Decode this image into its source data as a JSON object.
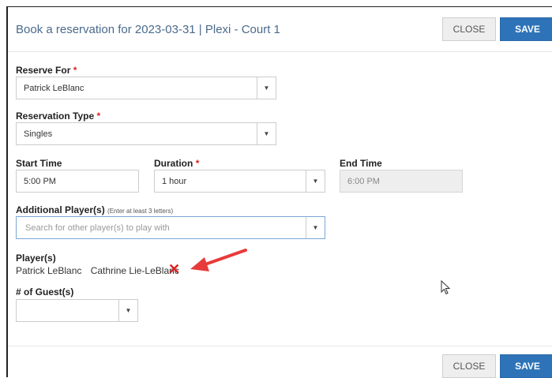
{
  "header": {
    "title": "Book a reservation for 2023-03-31 | Plexi - Court 1",
    "close_label": "CLOSE",
    "save_label": "SAVE"
  },
  "reserve_for": {
    "label": "Reserve For",
    "required_mark": "*",
    "value": "Patrick LeBlanc"
  },
  "reservation_type": {
    "label": "Reservation Type",
    "required_mark": "*",
    "value": "Singles"
  },
  "start_time": {
    "label": "Start Time",
    "value": "5:00 PM"
  },
  "duration": {
    "label": "Duration",
    "required_mark": "*",
    "value": "1 hour"
  },
  "end_time": {
    "label": "End Time",
    "value": "6:00 PM"
  },
  "additional_players": {
    "label": "Additional Player(s)",
    "hint": "(Enter at least 3 letters)",
    "placeholder": "Search for other player(s) to play with"
  },
  "players": {
    "label": "Player(s)",
    "list": [
      "Patrick LeBlanc",
      "Cathrine Lie-LeBlanc"
    ],
    "remove_icon": "✕"
  },
  "guests": {
    "label": "# of Guest(s)",
    "value": ""
  },
  "footer": {
    "close_label": "CLOSE",
    "save_label": "SAVE"
  },
  "colors": {
    "accent": "#2e73b8",
    "required": "#e02020",
    "arrow": "#e83a3a",
    "title": "#4a6a8c"
  },
  "icons": {
    "dropdown": "caret-down-icon",
    "remove": "close-x-icon",
    "annotation": "red-arrow-icon",
    "pointer": "mouse-cursor-icon"
  }
}
